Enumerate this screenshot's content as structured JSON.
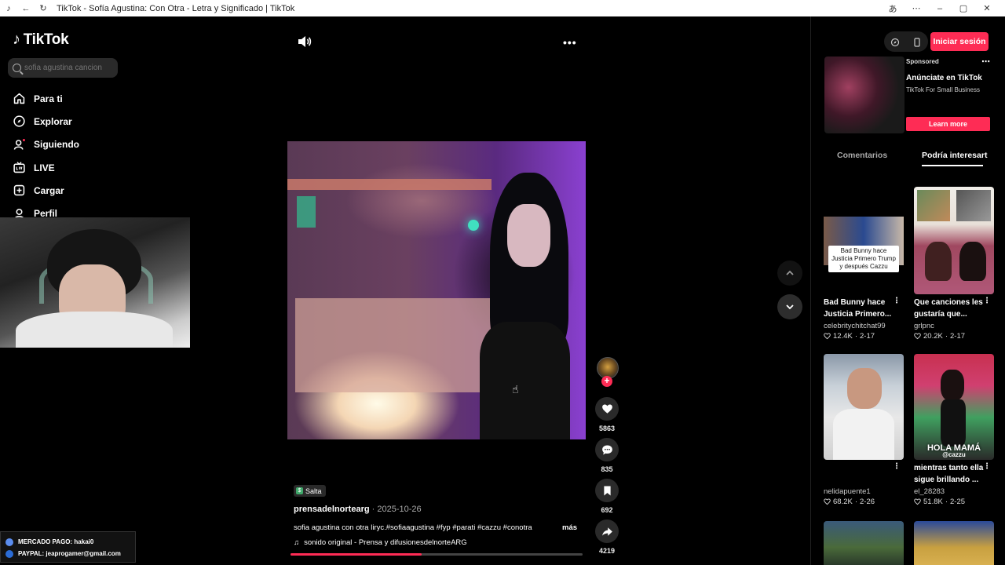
{
  "browser": {
    "title": "TikTok - Sofía Agustina: Con Otra - Letra y Significado | TikTok"
  },
  "sidebar": {
    "logo_text": "TikTok",
    "search_placeholder": "sofia agustina cancion",
    "items": [
      {
        "label": "Para ti",
        "icon": "home-icon"
      },
      {
        "label": "Explorar",
        "icon": "compass-icon"
      },
      {
        "label": "Siguiendo",
        "icon": "following-icon"
      },
      {
        "label": "LIVE",
        "icon": "live-icon"
      },
      {
        "label": "Cargar",
        "icon": "upload-icon"
      },
      {
        "label": "Perfil",
        "icon": "profile-icon"
      }
    ]
  },
  "overlay": {
    "mercado": "MERCADO PAGO: hakai0",
    "paypal": "PAYPAL: jeaprogamer@gmail.com"
  },
  "video": {
    "location": "Salta",
    "username": "prensadelnortearg",
    "date": "2025-10-26",
    "description": "sofia agustina con otra liryc.#sofiaagustina #fyp #parati #cazzu #conotra",
    "more_label": "más",
    "sound": "sonido original - Prensa y difusionesdelnorteARG",
    "progress": 0.45,
    "likes": "5863",
    "comments": "835",
    "saves": "692",
    "shares": "4219"
  },
  "right_panel": {
    "login_label": "Iniciar sesión",
    "ad": {
      "sponsored": "Sponsored",
      "title": "Anúnciate en TikTok",
      "subtitle": "TikTok For Small Business",
      "cta": "Learn more"
    },
    "tabs": {
      "comments": "Comentarios",
      "interest": "Podría interesarte"
    },
    "cards": [
      {
        "title": "Bad Bunny hace Justicia Primero...",
        "user": "celebritychitchat99",
        "likes": "12.4K",
        "date": "2-17",
        "caption": "Bad Bunny hace Justicia Primero Trump y después Cazzu"
      },
      {
        "title": "Que canciones les gustaría que...",
        "user": "grlpnc",
        "likes": "20.2K",
        "date": "2-17"
      },
      {
        "title": "",
        "user": "nelidapuente1",
        "likes": "68.2K",
        "date": "2-26"
      },
      {
        "title": "mientras tanto ella sigue brillando ...",
        "user": "el_28283",
        "likes": "51.8K",
        "date": "2-25",
        "overlay": "HOLA MAMÁ",
        "overlay_small": "@cazzu"
      }
    ]
  }
}
